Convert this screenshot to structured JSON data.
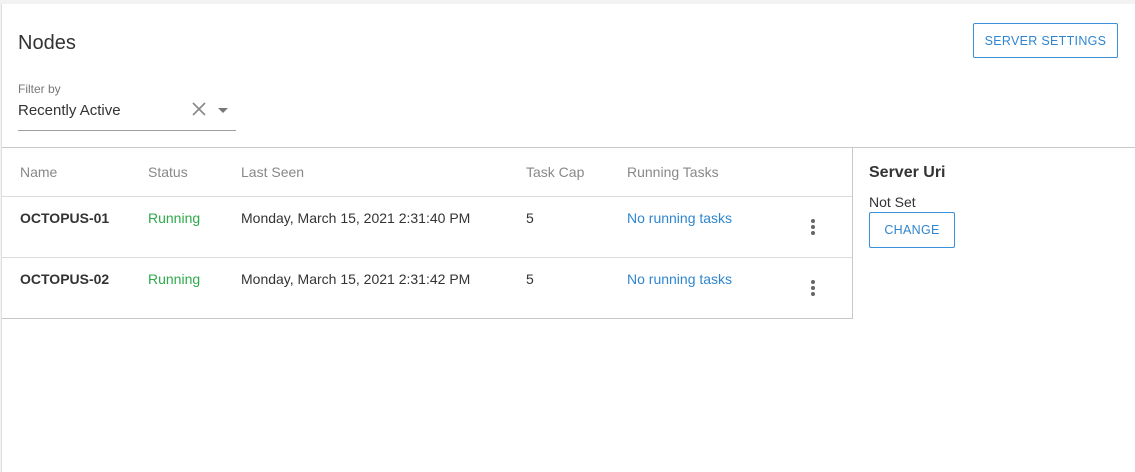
{
  "page": {
    "title": "Nodes",
    "server_settings_label": "SERVER SETTINGS"
  },
  "filter": {
    "label": "Filter by",
    "value": "Recently Active"
  },
  "table": {
    "headers": [
      "Name",
      "Status",
      "Last Seen",
      "Task Cap",
      "Running Tasks"
    ],
    "rows": [
      {
        "name": "OCTOPUS-01",
        "status": "Running",
        "last_seen": "Monday, March 15, 2021 2:31:40 PM",
        "task_cap": "5",
        "running_tasks": "No running tasks"
      },
      {
        "name": "OCTOPUS-02",
        "status": "Running",
        "last_seen": "Monday, March 15, 2021 2:31:42 PM",
        "task_cap": "5",
        "running_tasks": "No running tasks"
      }
    ]
  },
  "server_uri": {
    "title": "Server Uri",
    "value": "Not Set",
    "change_label": "CHANGE"
  },
  "colors": {
    "accent": "#2f86cf",
    "running": "#2eaa4a"
  },
  "icons": {
    "clear": "close-icon",
    "dropdown": "caret-down-icon",
    "row_menu": "more-vertical-icon"
  }
}
